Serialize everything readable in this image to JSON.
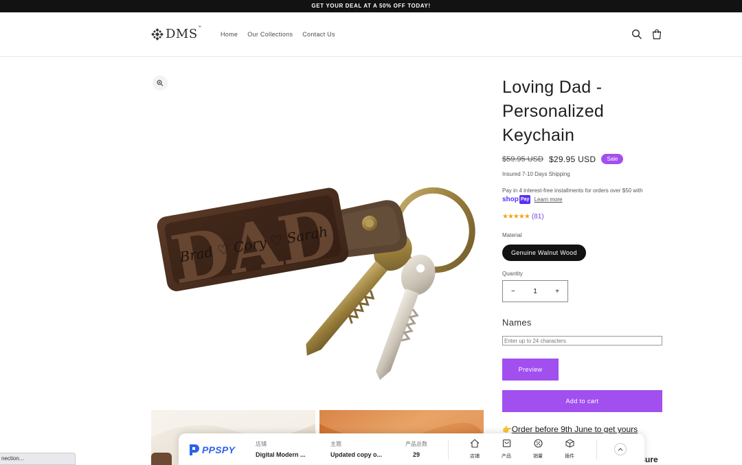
{
  "announcement": {
    "text": "GET YOUR DEAL AT A 50% OFF TODAY!"
  },
  "header": {
    "logo_text": "DMS",
    "logo_tm": "™",
    "nav": [
      "Home",
      "Our Collections",
      "Contact Us"
    ]
  },
  "product": {
    "title": "Loving Dad - Personalized Keychain",
    "image_engraving_big": "DAD",
    "image_engraving_names": "Brad ♡ Cory ♡ Sarah",
    "old_price": "$59.95 USD",
    "price": "$29.95 USD",
    "badge": "Sale",
    "shipping": "Insured 7-10 Days Shipping",
    "installments": "Pay in 4 interest-free installments for orders over $50 with",
    "shop_pay_shop": "shop",
    "shop_pay_pay": "Pay",
    "learn_more": "Learn more",
    "stars": "★★★★★",
    "rating_count": "(81)",
    "rating_value": 5,
    "material_label": "Material",
    "material_value": "Genuine Walnut Wood",
    "quantity_label": "Quantity",
    "quantity_minus": "−",
    "quantity_plus": "+",
    "quantity": "1",
    "names_label": "Names",
    "names_placeholder": "Enter up to 24 characters",
    "preview_button": "Preview",
    "add_to_cart": "Add to cart",
    "order_note": "Order before 9th June to get yours",
    "partial_heading": "easure"
  },
  "ppspy": {
    "brand": "PPSPY",
    "store_label": "店铺",
    "store_value": "Digital Modern ...",
    "theme_label": "主题",
    "theme_value": "Updated copy o...",
    "products_label": "产品总数",
    "products_value": "29",
    "icons": [
      {
        "name": "store",
        "label": "店铺"
      },
      {
        "name": "product",
        "label": "产品"
      },
      {
        "name": "sales",
        "label": "销量"
      },
      {
        "name": "plugin",
        "label": "插件"
      }
    ]
  },
  "status_bar": {
    "text": "nection..."
  },
  "colors": {
    "accent": "#a24ff0",
    "dark": "#121212",
    "shop_pay": "#5a31f4",
    "ppspy": "#2b62e8",
    "stars": "#f2a414"
  }
}
